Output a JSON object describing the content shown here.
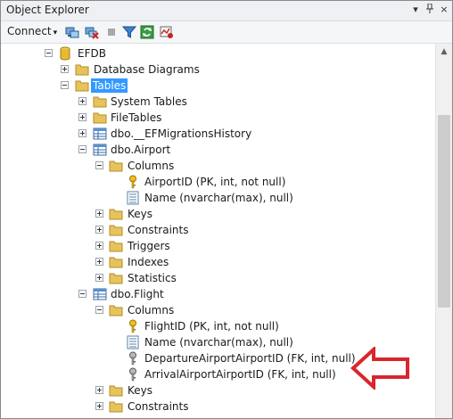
{
  "window": {
    "title": "Object Explorer",
    "pin_glyph": "▾",
    "pushpin_glyph": "❑",
    "close_glyph": "×"
  },
  "toolbar": {
    "connect_label": "Connect",
    "icons": [
      "connect-object-explorer-icon",
      "disconnect-icon",
      "stop-icon",
      "filter-icon",
      "refresh-icon",
      "activity-monitor-icon"
    ]
  },
  "tree": {
    "efdb": "EFDB",
    "database_diagrams": "Database Diagrams",
    "tables": "Tables",
    "system_tables": "System Tables",
    "file_tables": "FileTables",
    "ef_migrations": "dbo.__EFMigrationsHistory",
    "airport": {
      "name": "dbo.Airport",
      "columns": "Columns",
      "airport_id": "AirportID (PK, int, not null)",
      "name_col": "Name (nvarchar(max), null)",
      "keys": "Keys",
      "constraints": "Constraints",
      "triggers": "Triggers",
      "indexes": "Indexes",
      "statistics": "Statistics"
    },
    "flight": {
      "name": "dbo.Flight",
      "columns": "Columns",
      "flight_id": "FlightID (PK, int, not null)",
      "name_col": "Name (nvarchar(max), null)",
      "departure": "DepartureAirportAirportID (FK, int, null)",
      "arrival": "ArrivalAirportAirportID (FK, int, null)",
      "keys": "Keys",
      "constraints": "Constraints"
    }
  },
  "colors": {
    "selection": "#3399ff",
    "folder": "#e8c35a",
    "arrow": "#d9262b"
  }
}
